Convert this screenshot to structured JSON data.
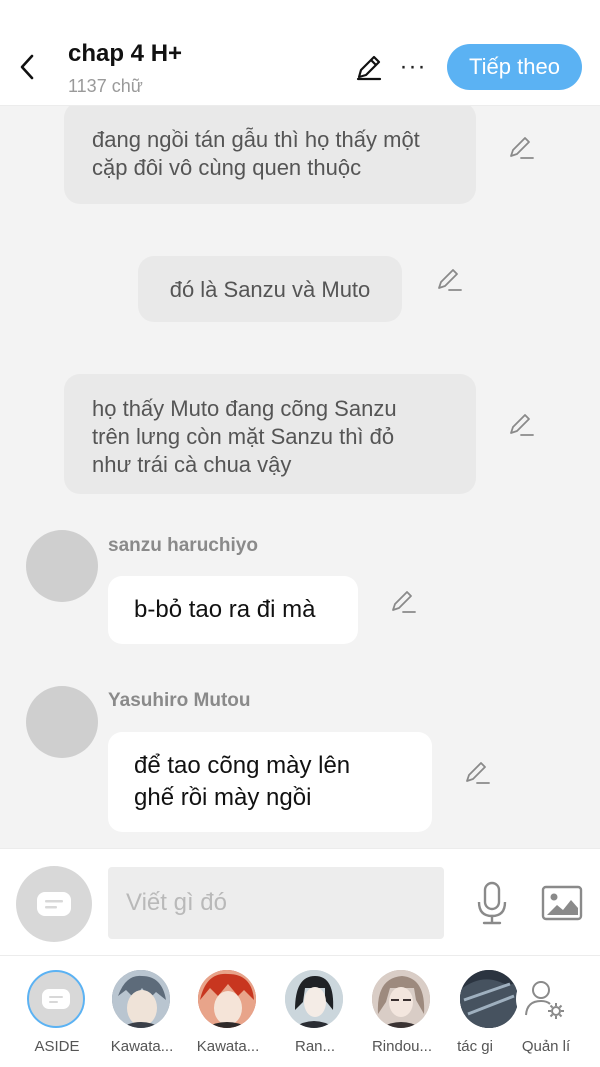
{
  "header": {
    "title": "chap 4 H+",
    "word_count": "1137 chữ",
    "next_label": "Tiếp theo",
    "more_label": "···"
  },
  "chat": {
    "narration_1": [
      "đang ngồi tán gẫu thì họ thấy một",
      "cặp đôi vô cùng quen thuộc"
    ],
    "narration_2": "đó là Sanzu và Muto",
    "narration_3": [
      "họ thấy Muto đang cõng Sanzu",
      "trên lưng còn mặt Sanzu thì đỏ",
      "như trái cà chua vậy"
    ],
    "msg_1": {
      "name": "sanzu haruchiyo",
      "text": "b-bỏ tao ra đi mà"
    },
    "msg_2": {
      "name": "Yasuhiro Mutou",
      "lines": [
        "để tao cõng mày lên",
        "ghế rồi mày ngồi"
      ]
    }
  },
  "composer": {
    "placeholder": "Viết gì đó"
  },
  "characters": [
    {
      "label": "ASIDE"
    },
    {
      "label": "Kawata..."
    },
    {
      "label": "Kawata..."
    },
    {
      "label": "Ran..."
    },
    {
      "label": "Rindou..."
    },
    {
      "label": "tác gi"
    },
    {
      "label": "Quản lí"
    }
  ],
  "colors": {
    "accent": "#5bb2f3",
    "narration_bg": "#e9e9e9",
    "chat_bg": "#f3f3f3"
  }
}
